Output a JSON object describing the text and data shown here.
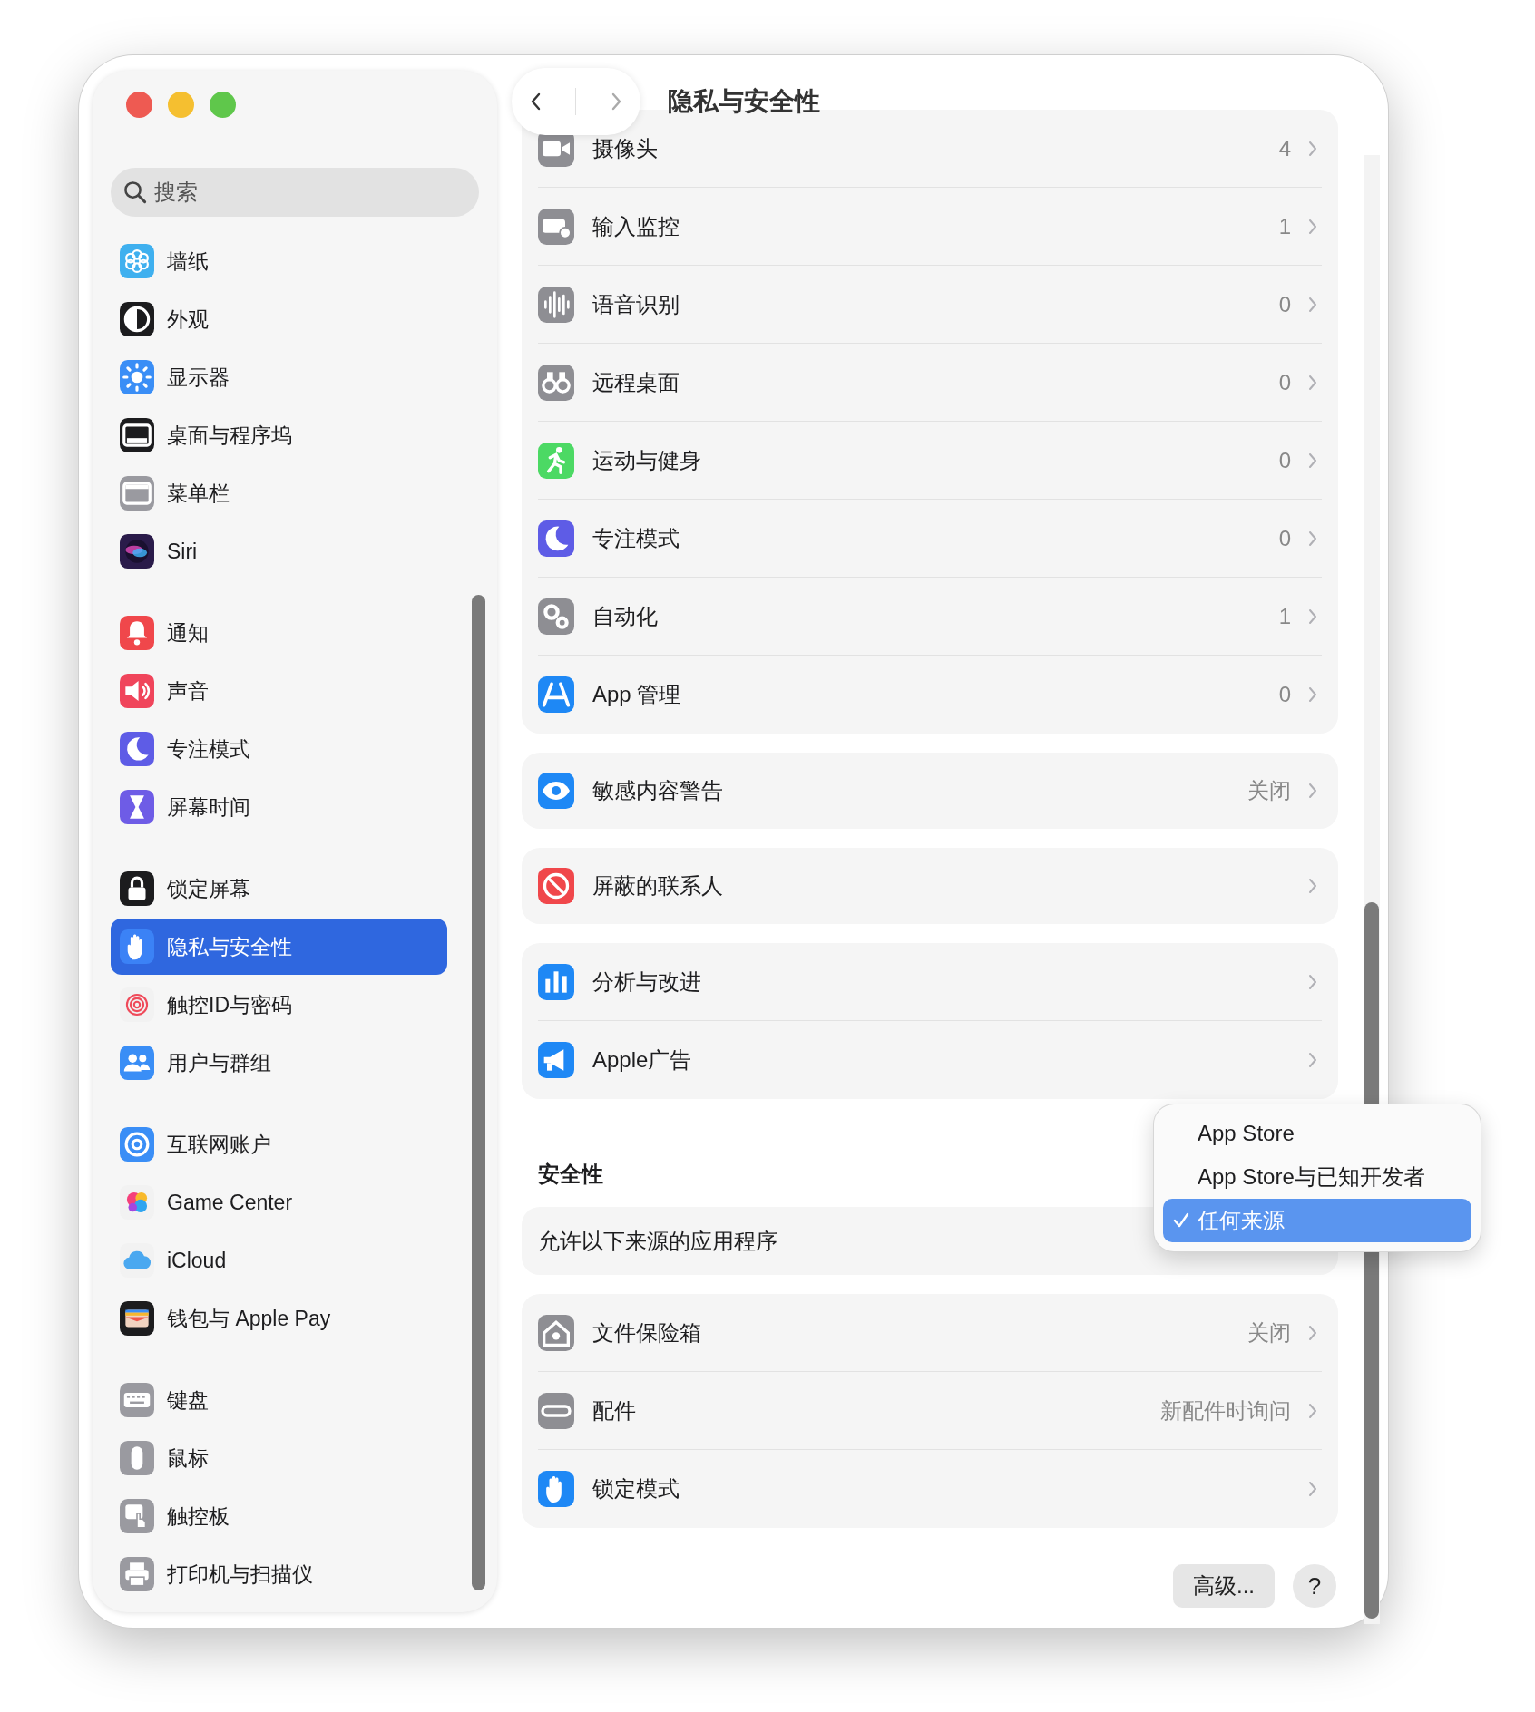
{
  "window": {
    "title": "隐私与安全性"
  },
  "sidebar": {
    "search": {
      "placeholder": "搜索"
    },
    "groups": [
      {
        "items": [
          {
            "label": "墙纸",
            "selected": false
          },
          {
            "label": "外观",
            "selected": false
          },
          {
            "label": "显示器",
            "selected": false
          },
          {
            "label": "桌面与程序坞",
            "selected": false
          },
          {
            "label": "菜单栏",
            "selected": false
          },
          {
            "label": "Siri",
            "selected": false
          }
        ]
      },
      {
        "items": [
          {
            "label": "通知",
            "selected": false
          },
          {
            "label": "声音",
            "selected": false
          },
          {
            "label": "专注模式",
            "selected": false
          },
          {
            "label": "屏幕时间",
            "selected": false
          }
        ]
      },
      {
        "items": [
          {
            "label": "锁定屏幕",
            "selected": false
          },
          {
            "label": "隐私与安全性",
            "selected": true
          },
          {
            "label": "触控ID与密码",
            "selected": false
          },
          {
            "label": "用户与群组",
            "selected": false
          }
        ]
      },
      {
        "items": [
          {
            "label": "互联网账户",
            "selected": false
          },
          {
            "label": "Game Center",
            "selected": false
          },
          {
            "label": "iCloud",
            "selected": false
          },
          {
            "label": "钱包与 Apple Pay",
            "selected": false
          }
        ]
      },
      {
        "items": [
          {
            "label": "键盘",
            "selected": false
          },
          {
            "label": "鼠标",
            "selected": false
          },
          {
            "label": "触控板",
            "selected": false
          },
          {
            "label": "打印机与扫描仪",
            "selected": false
          }
        ]
      }
    ]
  },
  "privacy_groups": [
    {
      "rows": [
        {
          "label": "摄像头",
          "value": "4"
        },
        {
          "label": "输入监控",
          "value": "1"
        },
        {
          "label": "语音识别",
          "value": "0"
        },
        {
          "label": "远程桌面",
          "value": "0"
        },
        {
          "label": "运动与健身",
          "value": "0"
        },
        {
          "label": "专注模式",
          "value": "0"
        },
        {
          "label": "自动化",
          "value": "1"
        },
        {
          "label": "App 管理",
          "value": "0"
        }
      ]
    },
    {
      "rows": [
        {
          "label": "敏感内容警告",
          "value": "关闭"
        }
      ]
    },
    {
      "rows": [
        {
          "label": "屏蔽的联系人"
        }
      ]
    },
    {
      "rows": [
        {
          "label": "分析与改进"
        },
        {
          "label": "Apple广告"
        }
      ]
    }
  ],
  "security": {
    "heading": "安全性",
    "allow_label": "允许以下来源的应用程序",
    "menu": [
      {
        "label": "App Store",
        "selected": false
      },
      {
        "label": "App Store与已知开发者",
        "selected": false
      },
      {
        "label": "任何来源",
        "selected": true
      }
    ]
  },
  "security_rows": [
    {
      "label": "文件保险箱",
      "value": "关闭"
    },
    {
      "label": "配件",
      "value": "新配件时询问"
    },
    {
      "label": "锁定模式"
    }
  ],
  "buttons": {
    "advanced": "高级...",
    "help": "?"
  }
}
